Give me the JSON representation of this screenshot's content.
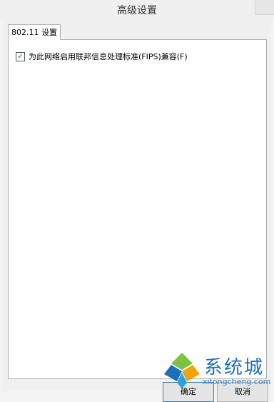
{
  "window": {
    "title": "高级设置"
  },
  "tabs": [
    {
      "label": "802.11 设置",
      "active": true
    }
  ],
  "settings": {
    "fips_checkbox": {
      "label": "为此网络启用联邦信息处理标准(FIPS)兼容(F)",
      "checked": true
    }
  },
  "buttons": {
    "ok": "确定",
    "cancel": "取消"
  },
  "watermark": {
    "brand": "系统城",
    "url": "xitongcheng.com"
  },
  "colors": {
    "accent": "#1a56c4",
    "watermark": "#1c6fb8"
  }
}
